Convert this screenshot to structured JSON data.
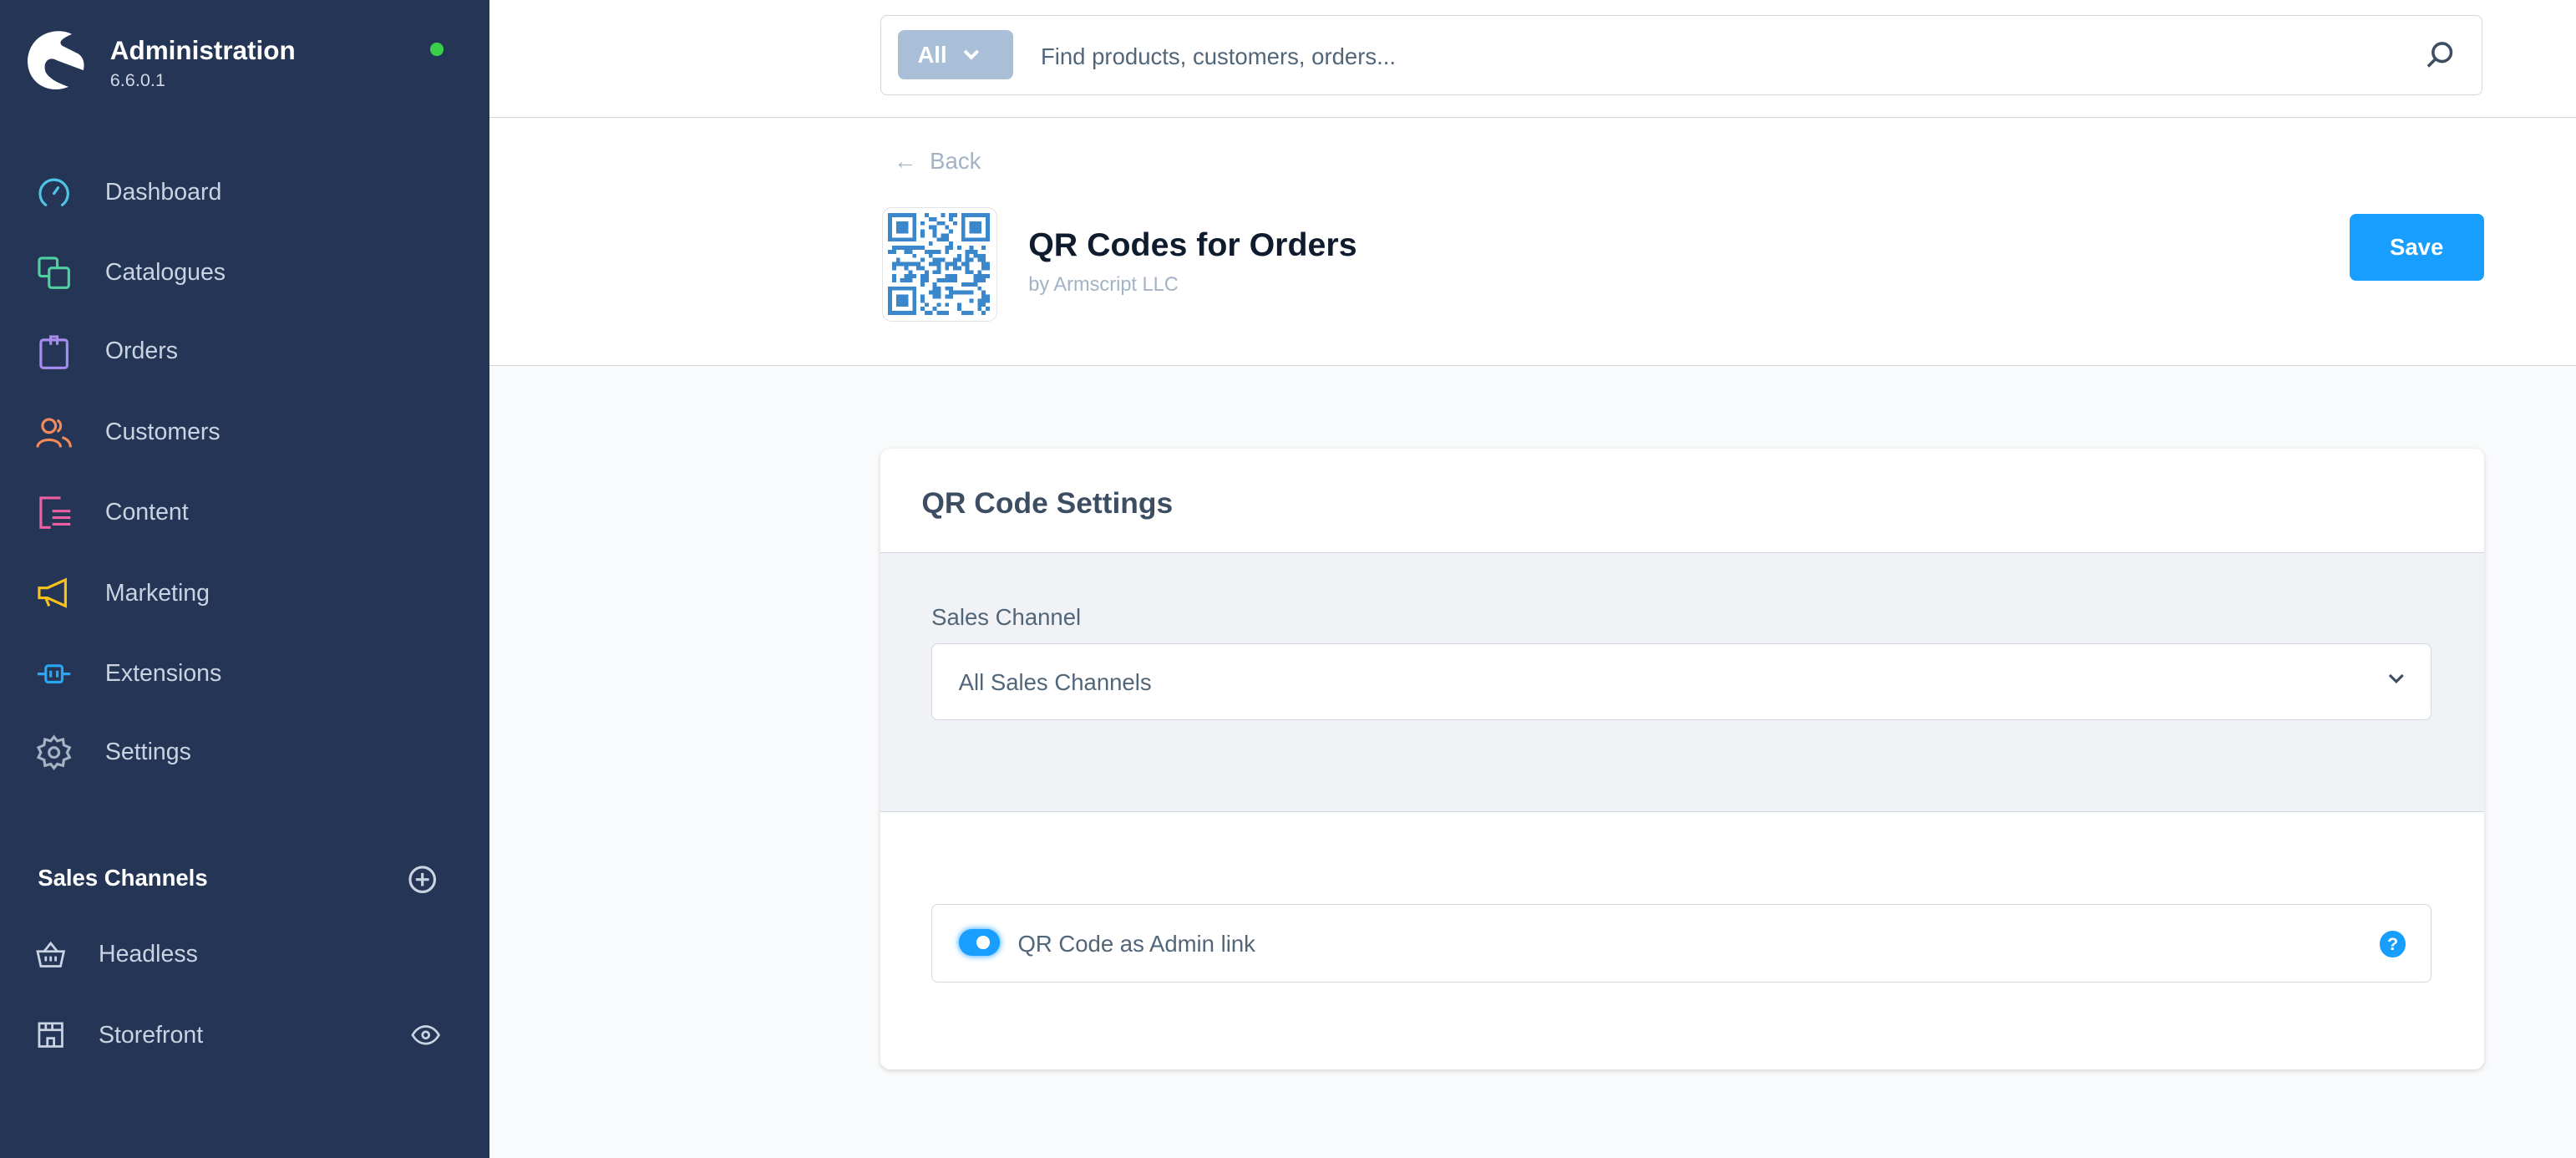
{
  "app": {
    "title": "Administration",
    "version": "6.6.0.1",
    "status_color": "#37d046"
  },
  "sidebar": {
    "items": [
      {
        "label": "Dashboard",
        "icon": "gauge-icon",
        "color": "#4ec5e6"
      },
      {
        "label": "Catalogues",
        "icon": "catalogue-icon",
        "color": "#4fd0a0"
      },
      {
        "label": "Orders",
        "icon": "shopping-bag-icon",
        "color": "#a88cf0"
      },
      {
        "label": "Customers",
        "icon": "users-icon",
        "color": "#f38a5a"
      },
      {
        "label": "Content",
        "icon": "content-icon",
        "color": "#ef5fa5"
      },
      {
        "label": "Marketing",
        "icon": "megaphone-icon",
        "color": "#f8c21b"
      },
      {
        "label": "Extensions",
        "icon": "plug-icon",
        "color": "#2aa6f5"
      },
      {
        "label": "Settings",
        "icon": "gear-icon",
        "color": "#a6b3c4"
      }
    ],
    "sales_channels": {
      "title": "Sales Channels",
      "items": [
        {
          "label": "Headless",
          "icon": "basket-icon"
        },
        {
          "label": "Storefront",
          "icon": "storefront-icon"
        }
      ]
    }
  },
  "search": {
    "type_label": "All",
    "placeholder": "Find products, customers, orders..."
  },
  "header": {
    "back_label": "Back",
    "title": "QR Codes for Orders",
    "author": "by Armscript LLC",
    "save_label": "Save",
    "accent": "#189eff"
  },
  "card": {
    "title": "QR Code Settings",
    "sales_channel_label": "Sales Channel",
    "sales_channel_value": "All Sales Channels",
    "toggle_label": "QR Code as Admin link",
    "toggle_on": true,
    "help_label": "?"
  }
}
